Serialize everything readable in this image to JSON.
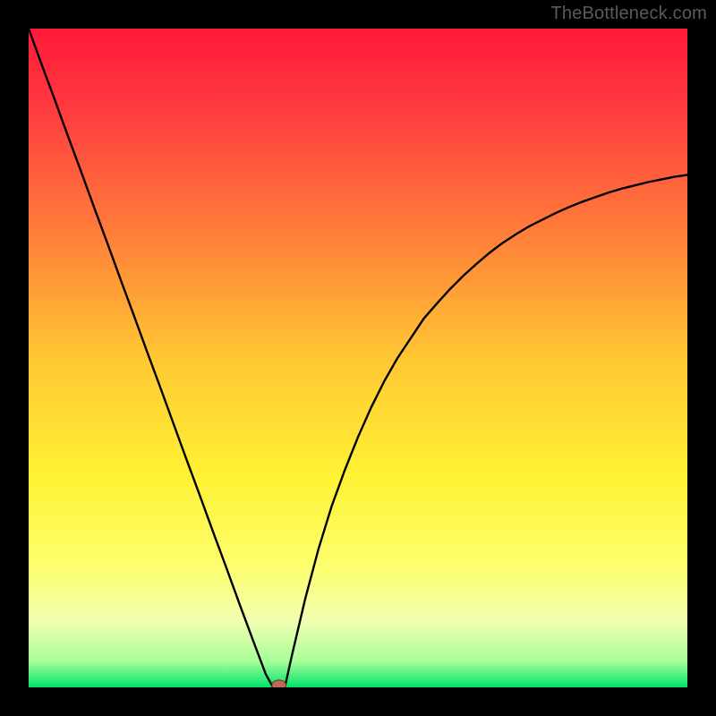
{
  "watermark": "TheBottleneck.com",
  "chart_data": {
    "type": "line",
    "title": "",
    "xlabel": "",
    "ylabel": "",
    "xlim": [
      0,
      100
    ],
    "ylim": [
      0,
      100
    ],
    "x": [
      0,
      2,
      4,
      6,
      8,
      10,
      12,
      14,
      16,
      18,
      20,
      22,
      24,
      26,
      28,
      30,
      32,
      34,
      36,
      37,
      38,
      39,
      40,
      42,
      44,
      46,
      48,
      50,
      52,
      54,
      56,
      58,
      60,
      62,
      64,
      66,
      68,
      70,
      72,
      74,
      76,
      78,
      80,
      82,
      84,
      86,
      88,
      90,
      92,
      94,
      96,
      98,
      100
    ],
    "values": [
      100,
      94.5,
      89.1,
      83.6,
      78.2,
      72.7,
      67.3,
      61.8,
      56.4,
      50.9,
      45.5,
      40.0,
      34.5,
      29.1,
      23.6,
      18.2,
      12.7,
      7.3,
      2.0,
      0.2,
      0.0,
      0.5,
      5.0,
      13.5,
      21.0,
      27.5,
      33.0,
      38.0,
      42.5,
      46.5,
      50.0,
      53.0,
      56.0,
      58.3,
      60.5,
      62.5,
      64.3,
      66.0,
      67.5,
      68.8,
      70.0,
      71.0,
      72.0,
      72.9,
      73.7,
      74.4,
      75.1,
      75.7,
      76.2,
      76.7,
      77.1,
      77.5,
      77.8
    ],
    "marker": {
      "x": 38,
      "y": 0.35
    },
    "gradient_stops": [
      {
        "offset": 0.0,
        "color": "#ff1a3a"
      },
      {
        "offset": 0.12,
        "color": "#ff3a3f"
      },
      {
        "offset": 0.3,
        "color": "#ff7a3a"
      },
      {
        "offset": 0.5,
        "color": "#ffc733"
      },
      {
        "offset": 0.68,
        "color": "#fff233"
      },
      {
        "offset": 0.82,
        "color": "#fdff70"
      },
      {
        "offset": 0.9,
        "color": "#f0ffb0"
      },
      {
        "offset": 0.96,
        "color": "#a8ff9a"
      },
      {
        "offset": 1.0,
        "color": "#00e36b"
      }
    ]
  }
}
